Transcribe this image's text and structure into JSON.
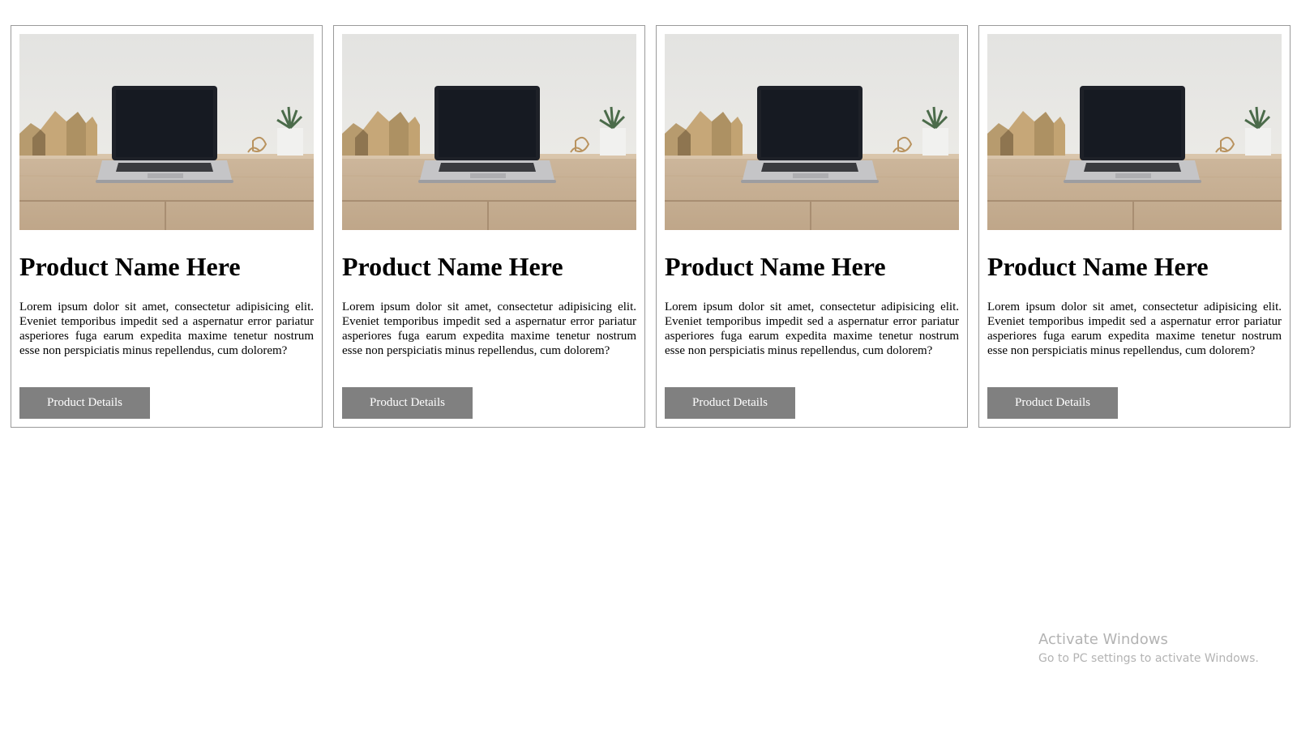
{
  "products": [
    {
      "image": "laptop-on-desk-photo",
      "title": "Product Name Here",
      "description": "Lorem ipsum dolor sit amet, consectetur adipisicing elit. Eveniet temporibus impedit sed a aspernatur error pariatur asperiores fuga earum expedita maxime tenetur nostrum esse non perspiciatis minus repellendus, cum dolorem?",
      "button_label": "Product Details"
    },
    {
      "image": "laptop-on-desk-photo",
      "title": "Product Name Here",
      "description": "Lorem ipsum dolor sit amet, consectetur adipisicing elit. Eveniet temporibus impedit sed a aspernatur error pariatur asperiores fuga earum expedita maxime tenetur nostrum esse non perspiciatis minus repellendus, cum dolorem?",
      "button_label": "Product Details"
    },
    {
      "image": "laptop-on-desk-photo",
      "title": "Product Name Here",
      "description": "Lorem ipsum dolor sit amet, consectetur adipisicing elit. Eveniet temporibus impedit sed a aspernatur error pariatur asperiores fuga earum expedita maxime tenetur nostrum esse non perspiciatis minus repellendus, cum dolorem?",
      "button_label": "Product Details"
    },
    {
      "image": "laptop-on-desk-photo",
      "title": "Product Name Here",
      "description": "Lorem ipsum dolor sit amet, consectetur adipisicing elit. Eveniet temporibus impedit sed a aspernatur error pariatur asperiores fuga earum expedita maxime tenetur nostrum esse non perspiciatis minus repellendus, cum dolorem?",
      "button_label": "Product Details"
    }
  ],
  "colors": {
    "button_bg": "#808080",
    "button_text": "#ffffff",
    "card_border": "#9a9a9a",
    "watermark_text": "#b3b3b3"
  },
  "watermark": {
    "title": "Activate Windows",
    "subtitle": "Go to PC settings to activate Windows."
  }
}
